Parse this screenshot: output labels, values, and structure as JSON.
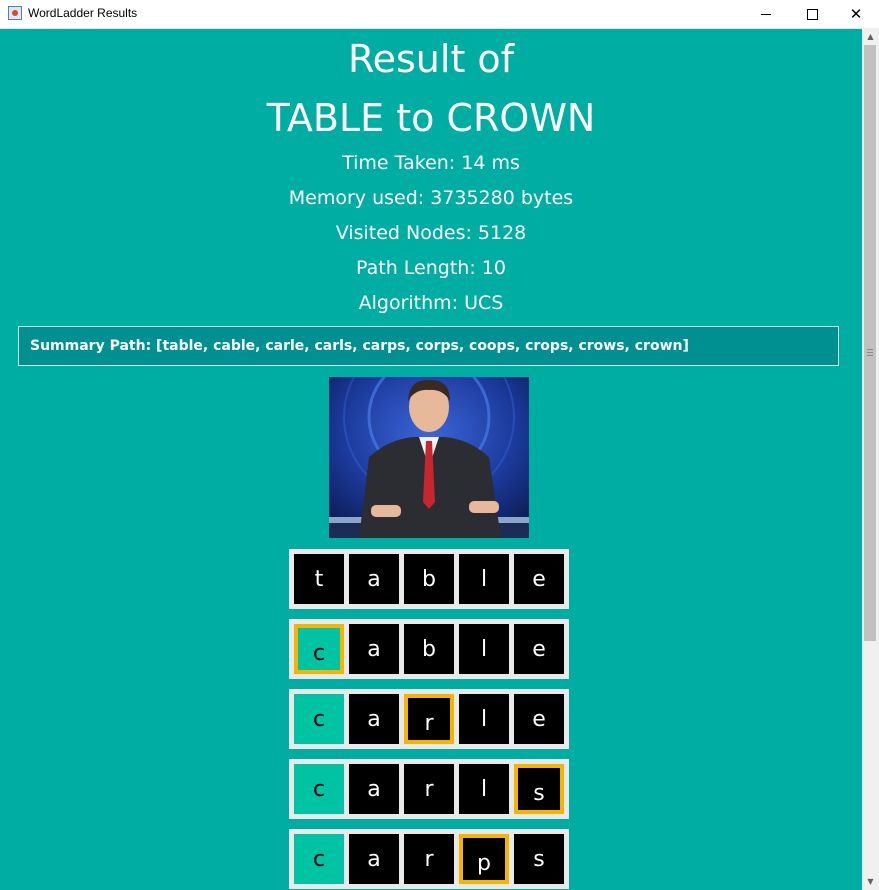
{
  "window": {
    "title": "WordLadder Results"
  },
  "header": {
    "line1": "Result of",
    "line2": "TABLE to CROWN"
  },
  "stats": {
    "time": "Time Taken: 14 ms",
    "memory": "Memory used: 3735280 bytes",
    "visited": "Visited Nodes: 5128",
    "path_length": "Path Length: 10",
    "algorithm": "Algorithm: UCS"
  },
  "summary": "Summary Path: [table, cable, carle, carls, carps, corps, coops, crops, crows, crown]",
  "ladder": [
    {
      "letters": [
        "t",
        "a",
        "b",
        "l",
        "e"
      ]
    },
    {
      "letters": [
        "c",
        "a",
        "b",
        "l",
        "e"
      ]
    },
    {
      "letters": [
        "c",
        "a",
        "r",
        "l",
        "e"
      ]
    },
    {
      "letters": [
        "c",
        "a",
        "r",
        "l",
        "s"
      ]
    },
    {
      "letters": [
        "c",
        "a",
        "r",
        "p",
        "s"
      ]
    }
  ],
  "colors": {
    "background": "#00ADA2",
    "summary_bg": "#009092",
    "match_tile": "#00C3A3",
    "changed_border": "#F5B400",
    "tile": "#000000"
  }
}
